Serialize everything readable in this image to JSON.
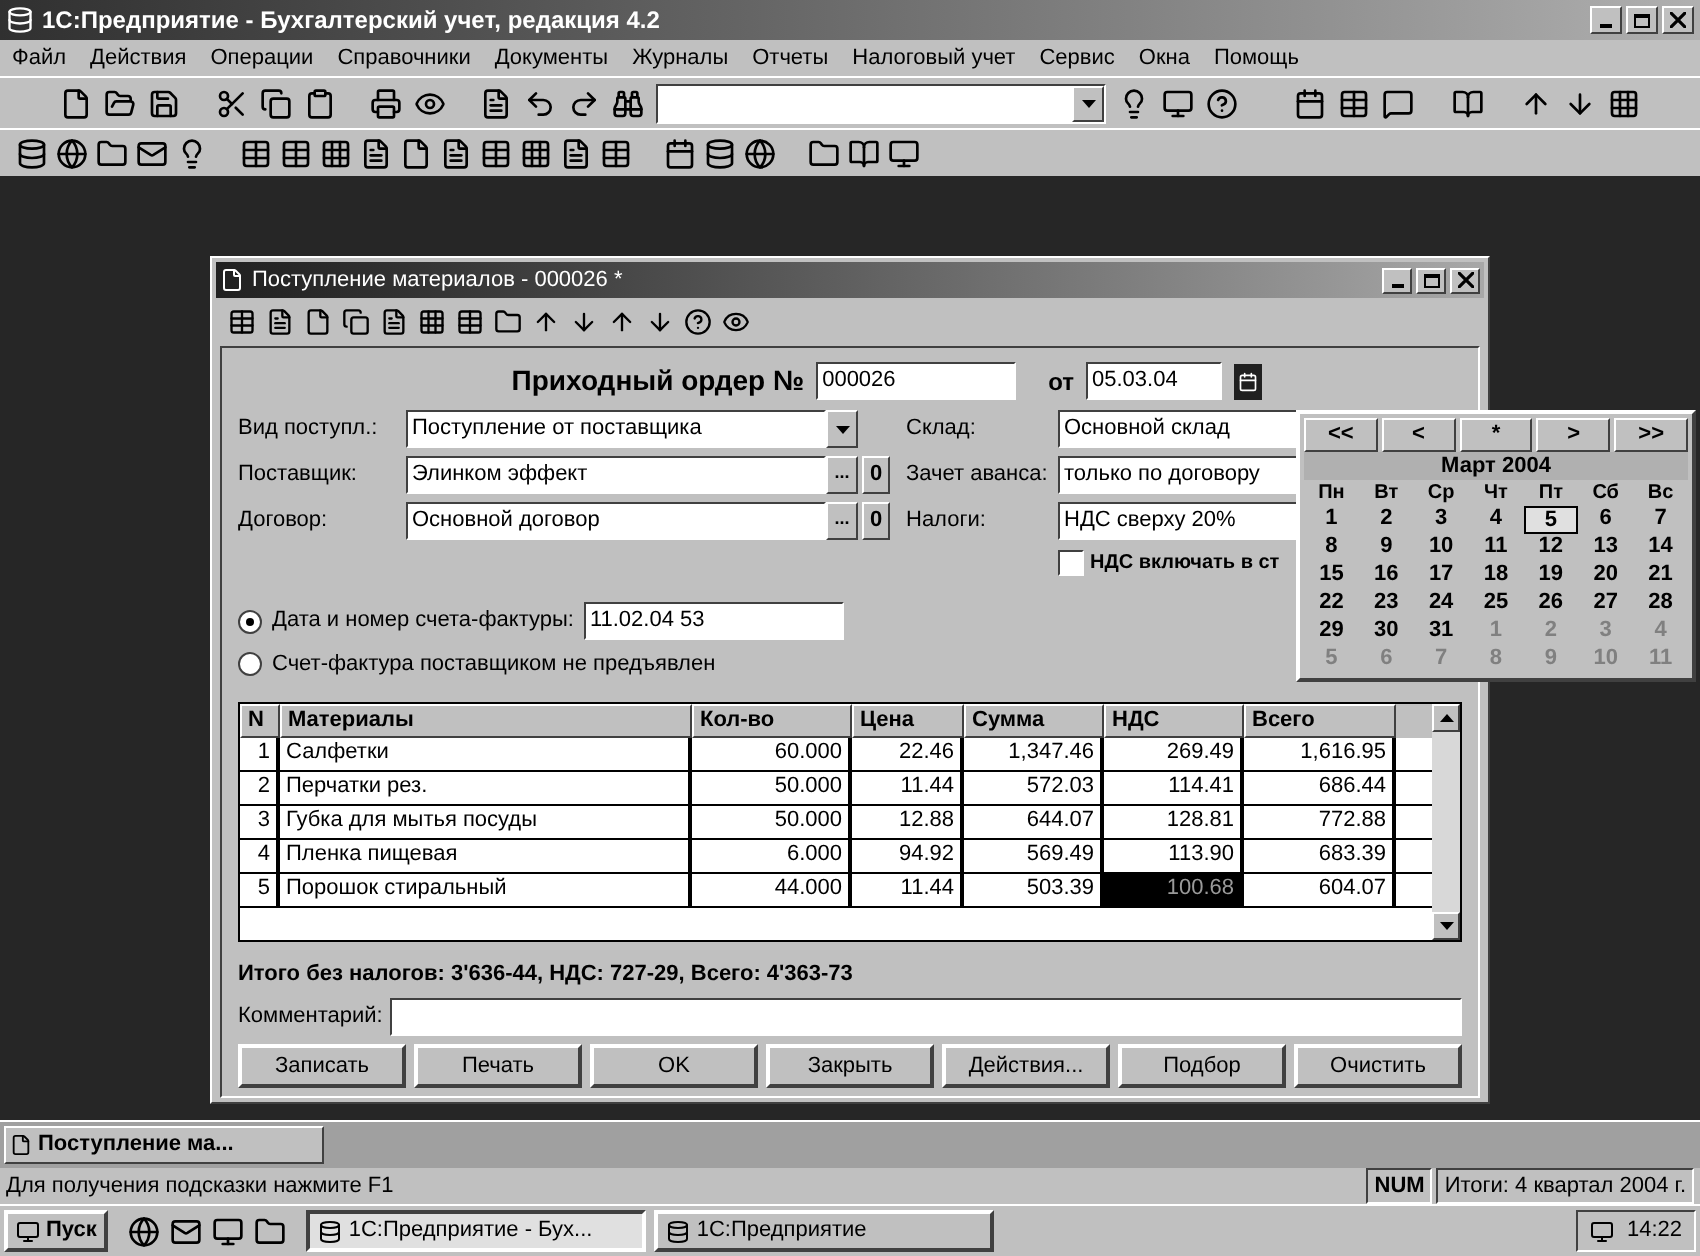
{
  "app_window": {
    "title": "1С:Предприятие - Бухгалтерский учет, редакция 4.2"
  },
  "menu": [
    "Файл",
    "Действия",
    "Операции",
    "Справочники",
    "Документы",
    "Журналы",
    "Отчеты",
    "Налоговый учет",
    "Сервис",
    "Окна",
    "Помощь"
  ],
  "document_window": {
    "title": "Поступление материалов - 000026 *",
    "heading": "Приходный ордер №",
    "number": "000026",
    "date_label": "от",
    "date": "05.03.04",
    "left_fields": [
      {
        "label": "Вид поступл.:",
        "value": "Поступление от поставщика",
        "kind": "dropdown"
      },
      {
        "label": "Поставщик:",
        "value": "Элинком эффект",
        "kind": "reference",
        "select_button": "...",
        "button": "0"
      },
      {
        "label": "Договор:",
        "value": "Основной договор",
        "kind": "reference",
        "select_button": "...",
        "button": "0"
      }
    ],
    "right_fields": [
      {
        "label": "Склад:",
        "value": "Основной склад"
      },
      {
        "label": "Зачет аванса:",
        "value": "только по договору"
      },
      {
        "label": "Налоги:",
        "value": "НДС сверху 20%"
      }
    ],
    "vat_checkbox": {
      "label": "НДС включать в ст",
      "checked": false
    },
    "invoice_options": [
      {
        "label": "Дата и номер счета-фактуры:",
        "selected": true,
        "value": "11.02.04 53"
      },
      {
        "label": "Счет-фактура поставщиком не предъявлен",
        "selected": false
      }
    ],
    "table": {
      "columns": [
        "N",
        "Материалы",
        "Кол-во",
        "Цена",
        "Сумма",
        "НДС",
        "Всего"
      ],
      "rows": [
        {
          "cells": [
            {
              "text": "1",
              "selected": false
            },
            {
              "text": "Салфетки",
              "selected": false
            },
            {
              "text": "60.000",
              "selected": false
            },
            {
              "text": "22.46",
              "selected": false
            },
            {
              "text": "1,347.46",
              "selected": false
            },
            {
              "text": "269.49",
              "selected": false
            },
            {
              "text": "1,616.95",
              "selected": false
            }
          ]
        },
        {
          "cells": [
            {
              "text": "2",
              "selected": false
            },
            {
              "text": "Перчатки рез.",
              "selected": false
            },
            {
              "text": "50.000",
              "selected": false
            },
            {
              "text": "11.44",
              "selected": false
            },
            {
              "text": "572.03",
              "selected": false
            },
            {
              "text": "114.41",
              "selected": false
            },
            {
              "text": "686.44",
              "selected": false
            }
          ]
        },
        {
          "cells": [
            {
              "text": "3",
              "selected": false
            },
            {
              "text": "Губка для мытья посуды",
              "selected": false
            },
            {
              "text": "50.000",
              "selected": false
            },
            {
              "text": "12.88",
              "selected": false
            },
            {
              "text": "644.07",
              "selected": false
            },
            {
              "text": "128.81",
              "selected": false
            },
            {
              "text": "772.88",
              "selected": false
            }
          ]
        },
        {
          "cells": [
            {
              "text": "4",
              "selected": false
            },
            {
              "text": "Пленка пищевая",
              "selected": false
            },
            {
              "text": "6.000",
              "selected": false
            },
            {
              "text": "94.92",
              "selected": false
            },
            {
              "text": "569.49",
              "selected": false
            },
            {
              "text": "113.90",
              "selected": false
            },
            {
              "text": "683.39",
              "selected": false
            }
          ]
        },
        {
          "cells": [
            {
              "text": "5",
              "selected": false
            },
            {
              "text": "Порошок стиральный",
              "selected": false
            },
            {
              "text": "44.000",
              "selected": false
            },
            {
              "text": "11.44",
              "selected": false
            },
            {
              "text": "503.39",
              "selected": false
            },
            {
              "text": "100.68",
              "selected": true
            },
            {
              "text": "604.07",
              "selected": false
            }
          ]
        }
      ]
    },
    "totals": "Итого без налогов: 3'636-44, НДС: 727-29, Всего: 4'363-73",
    "comment_label": "Комментарий:",
    "buttons": [
      "Записать",
      "Печать",
      "OK",
      "Закрыть",
      "Действия...",
      "Подбор",
      "Очистить"
    ]
  },
  "calendar": {
    "nav": [
      "<<",
      "<",
      "*",
      ">",
      ">>"
    ],
    "month": "Март 2004",
    "weekdays": [
      "Пн",
      "Вт",
      "Ср",
      "Чт",
      "Пт",
      "Сб",
      "Вс"
    ],
    "days": [
      {
        "day": "1",
        "current_month": true,
        "selected": false
      },
      {
        "day": "2",
        "current_month": true,
        "selected": false
      },
      {
        "day": "3",
        "current_month": true,
        "selected": false
      },
      {
        "day": "4",
        "current_month": true,
        "selected": false
      },
      {
        "day": "5",
        "current_month": true,
        "selected": true
      },
      {
        "day": "6",
        "current_month": true,
        "selected": false
      },
      {
        "day": "7",
        "current_month": true,
        "selected": false
      },
      {
        "day": "8",
        "current_month": true,
        "selected": false
      },
      {
        "day": "9",
        "current_month": true,
        "selected": false
      },
      {
        "day": "10",
        "current_month": true,
        "selected": false
      },
      {
        "day": "11",
        "current_month": true,
        "selected": false
      },
      {
        "day": "12",
        "current_month": true,
        "selected": false
      },
      {
        "day": "13",
        "current_month": true,
        "selected": false
      },
      {
        "day": "14",
        "current_month": true,
        "selected": false
      },
      {
        "day": "15",
        "current_month": true,
        "selected": false
      },
      {
        "day": "16",
        "current_month": true,
        "selected": false
      },
      {
        "day": "17",
        "current_month": true,
        "selected": false
      },
      {
        "day": "18",
        "current_month": true,
        "selected": false
      },
      {
        "day": "19",
        "current_month": true,
        "selected": false
      },
      {
        "day": "20",
        "current_month": true,
        "selected": false
      },
      {
        "day": "21",
        "current_month": true,
        "selected": false
      },
      {
        "day": "22",
        "current_month": true,
        "selected": false
      },
      {
        "day": "23",
        "current_month": true,
        "selected": false
      },
      {
        "day": "24",
        "current_month": true,
        "selected": false
      },
      {
        "day": "25",
        "current_month": true,
        "selected": false
      },
      {
        "day": "26",
        "current_month": true,
        "selected": false
      },
      {
        "day": "27",
        "current_month": true,
        "selected": false
      },
      {
        "day": "28",
        "current_month": true,
        "selected": false
      },
      {
        "day": "29",
        "current_month": true,
        "selected": false
      },
      {
        "day": "30",
        "current_month": true,
        "selected": false
      },
      {
        "day": "31",
        "current_month": true,
        "selected": false
      },
      {
        "day": "1",
        "current_month": false,
        "selected": false
      },
      {
        "day": "2",
        "current_month": false,
        "selected": false
      },
      {
        "day": "3",
        "current_month": false,
        "selected": false
      },
      {
        "day": "4",
        "current_month": false,
        "selected": false
      },
      {
        "day": "5",
        "current_month": false,
        "selected": false
      },
      {
        "day": "6",
        "current_month": false,
        "selected": false
      },
      {
        "day": "7",
        "current_month": false,
        "selected": false
      },
      {
        "day": "8",
        "current_month": false,
        "selected": false
      },
      {
        "day": "9",
        "current_month": false,
        "selected": false
      },
      {
        "day": "10",
        "current_month": false,
        "selected": false
      },
      {
        "day": "11",
        "current_month": false,
        "selected": false
      }
    ]
  },
  "minimized_window": {
    "title": "Поступление ма..."
  },
  "status_bar": {
    "hint": "Для получения подсказки нажмите F1",
    "num": "NUM",
    "period": "Итоги: 4 квартал 2004 г."
  },
  "taskbar": {
    "start": "Пуск",
    "tasks": [
      {
        "label": "1С:Предприятие - Бух...",
        "selected": true
      },
      {
        "label": "1С:Предприятие",
        "selected": false
      }
    ],
    "clock": "14:22"
  }
}
